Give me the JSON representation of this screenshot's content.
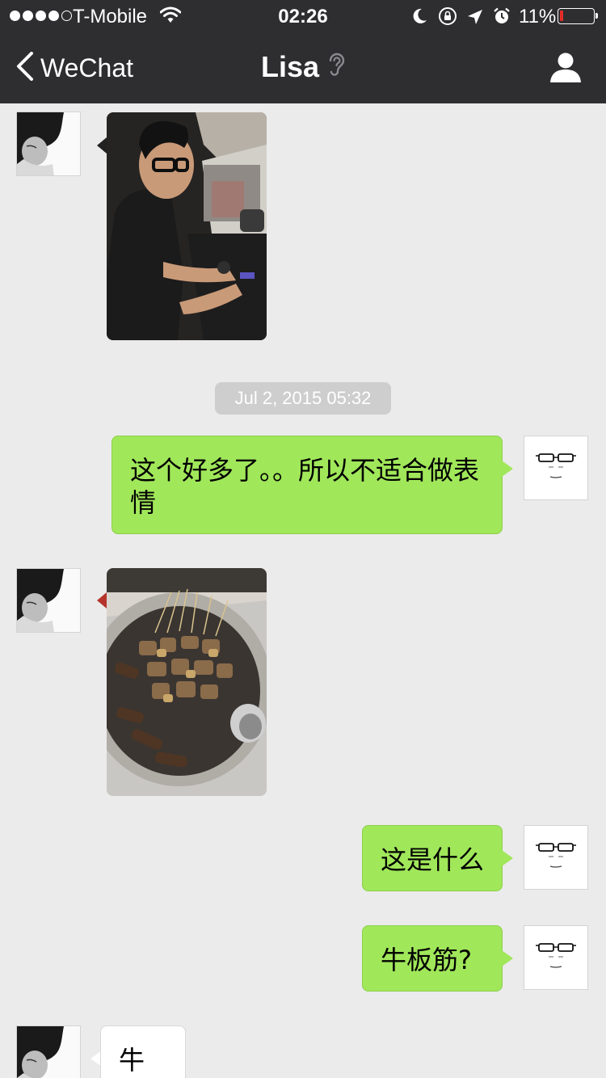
{
  "status_bar": {
    "carrier": "T-Mobile",
    "time": "02:26",
    "battery": "11%",
    "battery_level": 0.11,
    "signal_bars_filled": 4,
    "signal_bars_total": 5,
    "icons": [
      "wifi-icon",
      "moon-icon",
      "rotation-lock-icon",
      "location-arrow-icon",
      "alarm-icon",
      "battery-icon"
    ]
  },
  "nav": {
    "back_label": "WeChat",
    "title": "Lisa",
    "icons": [
      "chevron-left-icon",
      "ear-icon",
      "profile-icon"
    ]
  },
  "colors": {
    "nav_bg": "#2e2e31",
    "chat_bg": "#ebebeb",
    "outgoing_bubble": "#a0e75a",
    "incoming_bubble": "#ffffff",
    "timestamp_bg": "#cecece",
    "battery_low": "#e52d27"
  },
  "messages": [
    {
      "sender": "Lisa",
      "type": "image",
      "subject": "man wearing glasses driving a car"
    },
    {
      "type": "timestamp",
      "text": "Jul 2, 2015 05:32"
    },
    {
      "sender": "me",
      "type": "text",
      "text": "这个好多了。。所以不适合做表情"
    },
    {
      "sender": "Lisa",
      "type": "image",
      "subject": "tray of skewered grilled meat"
    },
    {
      "sender": "me",
      "type": "text",
      "text": "这是什么"
    },
    {
      "sender": "me",
      "type": "text",
      "text": "牛板筋?"
    },
    {
      "sender": "Lisa",
      "type": "text",
      "text": "牛杂"
    }
  ]
}
